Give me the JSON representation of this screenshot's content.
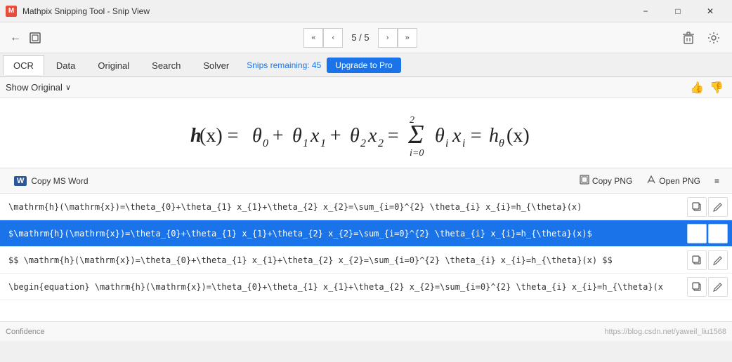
{
  "titleBar": {
    "title": "Mathpix Snipping Tool - Snip View",
    "minimize": "−",
    "maximize": "□",
    "close": "✕"
  },
  "toolbar": {
    "navFirst": "«",
    "navPrev": "‹",
    "pageIndicator": "5 / 5",
    "navNext": "›",
    "navLast": "»",
    "deleteIcon": "🗑",
    "settingsIcon": "⚙"
  },
  "tabs": {
    "items": [
      "OCR",
      "Data",
      "Original",
      "Search",
      "Solver"
    ],
    "active": "OCR",
    "snipsRemaining": "Snips remaining: 45",
    "upgradeLabel": "Upgrade to Pro"
  },
  "showOriginal": {
    "label": "Show Original",
    "chevron": "∨"
  },
  "math": {
    "formula": "h(x) = θ₀ + θ₁x₁ + θ₂x₂ = Σ θᵢxᵢ = hθ(x)"
  },
  "copyToolbar": {
    "copyMSWord": "Copy MS Word",
    "copyPNG": "Copy PNG",
    "openPNG": "Open PNG",
    "settingsIcon": "≡"
  },
  "formulas": [
    {
      "id": "inline",
      "text": "\\mathrm{h}(\\mathrm{x})=\\theta_{0}+\\theta_{1}  x_{1}+\\theta_{2}  x_{2}=\\sum_{i=0}^{2}  \\theta_{i}  x_{i}=h_{\\theta}(x)",
      "selected": false
    },
    {
      "id": "dollar",
      "text": "$\\mathrm{h}(\\mathrm{x})=\\theta_{0}+\\theta_{1}  x_{1}+\\theta_{2}  x_{2}=\\sum_{i=0}^{2}  \\theta_{i}  x_{i}=h_{\\theta}(x)$",
      "selected": true
    },
    {
      "id": "double-dollar",
      "text": "$$   \\mathrm{h}(\\mathrm{x})=\\theta_{0}+\\theta_{1}  x_{1}+\\theta_{2}  x_{2}=\\sum_{i=0}^{2}  \\theta_{i}  x_{i}=h_{\\theta}(x)   $$",
      "selected": false
    },
    {
      "id": "equation",
      "text": "\\begin{equation}   \\mathrm{h}(\\mathrm{x})=\\theta_{0}+\\theta_{1}  x_{1}+\\theta_{2}  x_{2}=\\sum_{i=0}^{2}  \\theta_{i}  x_{i}=h_{\\theta}(x",
      "selected": false
    }
  ],
  "footer": {
    "confidence": "Confidence",
    "watermark": "https://blog.csdn.net/yaweil_liu1568"
  },
  "icons": {
    "copy": "⧉",
    "edit": "✏",
    "word": "W",
    "thumbup": "👍",
    "thumbdown": "👎"
  }
}
